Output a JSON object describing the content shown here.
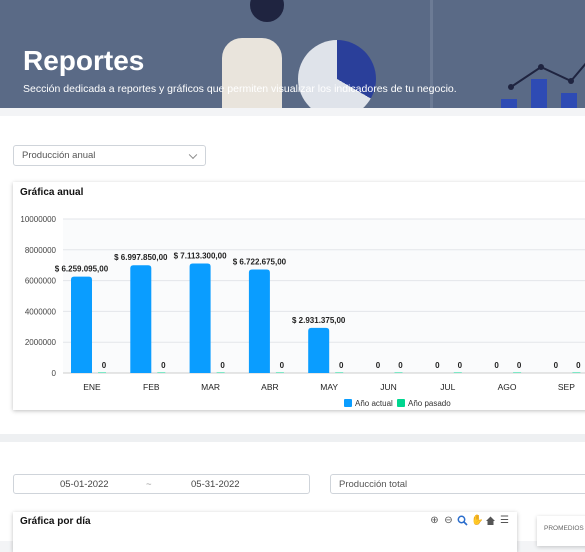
{
  "header": {
    "title": "Reportes",
    "subtitle": "Sección dedicada a reportes y gráficos que permiten visualizar los indicadores de tu negocio."
  },
  "filters": {
    "production_select": "Producción anual",
    "date_from": "05-01-2022",
    "date_separator": "~",
    "date_to": "05-31-2022",
    "total_select": "Producción total"
  },
  "annual_card": {
    "title": "Gráfica anual"
  },
  "daily_card": {
    "title": "Gráfica por día"
  },
  "side_card": {
    "label": "PROMEDIOS"
  },
  "colors": {
    "actual": "#0a9dff",
    "pasado": "#00d68f",
    "banner": "#5a6a86"
  },
  "chart_data": {
    "type": "bar",
    "categories": [
      "ENE",
      "FEB",
      "MAR",
      "ABR",
      "MAY",
      "JUN",
      "JUL",
      "AGO",
      "SEP"
    ],
    "series": [
      {
        "name": "Año actual",
        "values": [
          6259095,
          6997850,
          7113300,
          6722675,
          2931375,
          0,
          0,
          0,
          0
        ],
        "labels": [
          "$ 6.259.095,00",
          "$ 6.997.850,00",
          "$ 7.113.300,00",
          "$ 6.722.675,00",
          "$ 2.931.375,00",
          "0",
          "0",
          "0",
          "0"
        ]
      },
      {
        "name": "Año pasado",
        "values": [
          0,
          0,
          0,
          0,
          0,
          0,
          0,
          0,
          0
        ],
        "labels": [
          "0",
          "0",
          "0",
          "0",
          "0",
          "0",
          "0",
          "0",
          "0"
        ]
      }
    ],
    "yticks": [
      "0",
      "2000000",
      "4000000",
      "6000000",
      "8000000",
      "10000000"
    ],
    "ylim": [
      0,
      10000000
    ],
    "grid": true,
    "legend": "bottom"
  }
}
